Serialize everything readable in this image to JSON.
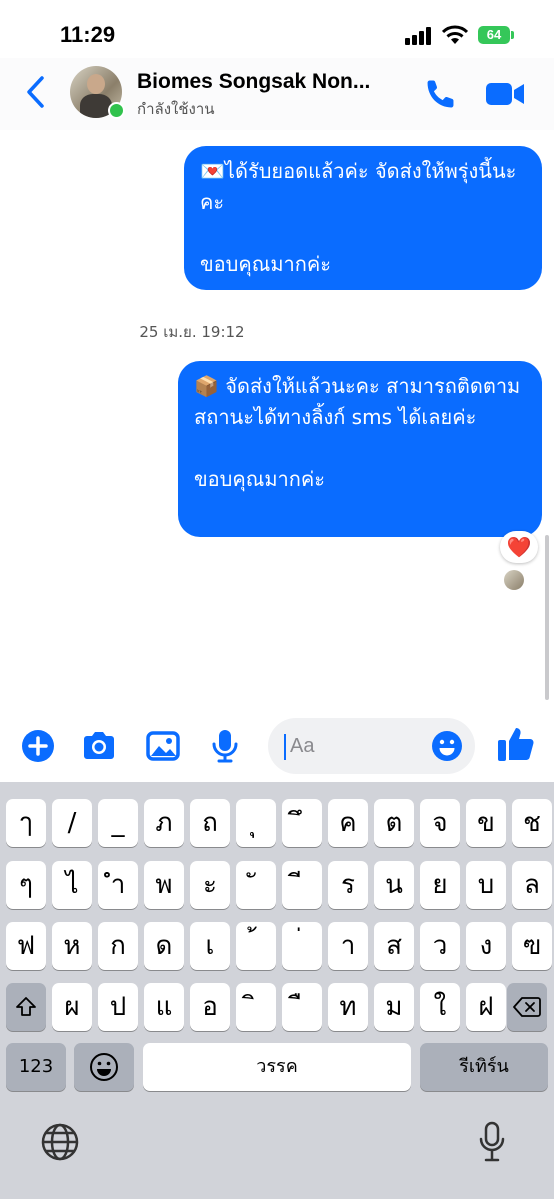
{
  "status_bar": {
    "time": "11:29",
    "battery": "64"
  },
  "header": {
    "contact_name": "Biomes Songsak Non...",
    "status": "กำลังใช้งาน"
  },
  "messages": [
    {
      "text": "💌ได้รับยอดแล้วค่ะ จัดส่งให้พรุ่งนี้นะคะ\n\nขอบคุณมากค่ะ"
    },
    {
      "text": "📦 จัดส่งให้แล้วนะคะ สามารถติดตามสถานะได้ทางลิ้งก์ sms ได้เลยค่ะ\n\nขอบคุณมากค่ะ",
      "reaction": "❤️"
    }
  ],
  "timestamp": "25 เม.ย. 19:12",
  "composer": {
    "placeholder": "Aa"
  },
  "keyboard": {
    "row1": [
      "ๅ",
      "/",
      "_",
      "ภ",
      "ถ",
      "ุ",
      "ึ",
      "ค",
      "ต",
      "จ",
      "ข",
      "ช"
    ],
    "row2": [
      "ๆ",
      "ไ",
      "ำ",
      "พ",
      "ะ",
      "ั",
      "ี",
      "ร",
      "น",
      "ย",
      "บ",
      "ล"
    ],
    "row3": [
      "ฟ",
      "ห",
      "ก",
      "ด",
      "เ",
      "้",
      "่",
      "า",
      "ส",
      "ว",
      "ง",
      "ฃ"
    ],
    "row4": [
      "ผ",
      "ป",
      "แ",
      "อ",
      "ิ",
      "ื",
      "ท",
      "ม",
      "ใ",
      "ฝ"
    ],
    "numbers_key": "123",
    "space_key": "วรรค",
    "return_key": "รีเทิร์น"
  },
  "colors": {
    "accent": "#0a6cff",
    "online": "#31c24d",
    "battery": "#35c759"
  }
}
